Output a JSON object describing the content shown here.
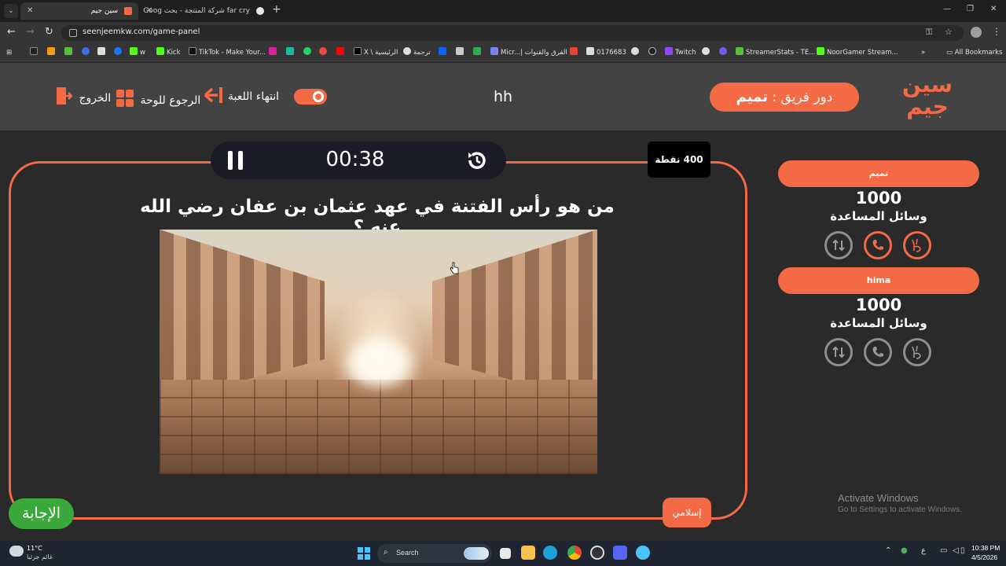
{
  "browser": {
    "tabs": [
      {
        "title": "سين جيم",
        "active": true
      },
      {
        "title": "far cry شركة المنتجة - بحث Goog",
        "active": false
      }
    ],
    "new_tab": "+",
    "url": "seenjeemkw.com/game-panel",
    "bookmarks": [
      "w",
      "Kick",
      "TikTok - Make Your...",
      "X \\ الرئيسية",
      "ترجمة",
      "Micr...| الفرق والقنوات",
      "0176683",
      "Twitch",
      "StreamerStats - TE...",
      "NoorGamer Stream..."
    ],
    "all_bookmarks": "All Bookmarks"
  },
  "header": {
    "logo_line1": "سين",
    "logo_line2": "جيم",
    "turn_label": "دور فريق :",
    "turn_team": "تميم",
    "game_name": "hh",
    "end_game": "انتهاء اللعبة",
    "back_to_board": "الرجوع للوحة",
    "exit": "الخروج"
  },
  "question": {
    "timer": "00:38",
    "points": "400 نقطة",
    "text": "من هو رأس الفتنة في عهد عثمان بن عفان رضي الله عنه ؟",
    "category": "إسلامي",
    "answer_button": "الإجابة"
  },
  "teams": [
    {
      "name": "تميم",
      "score": "1000",
      "aids_label": "وسائل المساعدة",
      "aids": [
        {
          "icon": "two-answers-icon",
          "active": true
        },
        {
          "icon": "phone-icon",
          "active": true
        },
        {
          "icon": "swap-icon",
          "active": false
        }
      ]
    },
    {
      "name": "hima",
      "score": "1000",
      "aids_label": "وسائل المساعدة",
      "aids": [
        {
          "icon": "two-answers-icon",
          "active": false
        },
        {
          "icon": "phone-icon",
          "active": false
        },
        {
          "icon": "swap-icon",
          "active": false
        }
      ]
    }
  ],
  "watermark": {
    "title": "Activate Windows",
    "subtitle": "Go to Settings to activate Windows."
  },
  "taskbar": {
    "temp": "11°C",
    "weather": "غائم جزئيا",
    "search": "Search",
    "tray_lang": "ع",
    "time": "10:38 PM",
    "date": "4/5/2026"
  },
  "colors": {
    "accent": "#f36a45",
    "answer": "#3aa83a",
    "background": "#2a2a2a",
    "header": "#434343"
  }
}
